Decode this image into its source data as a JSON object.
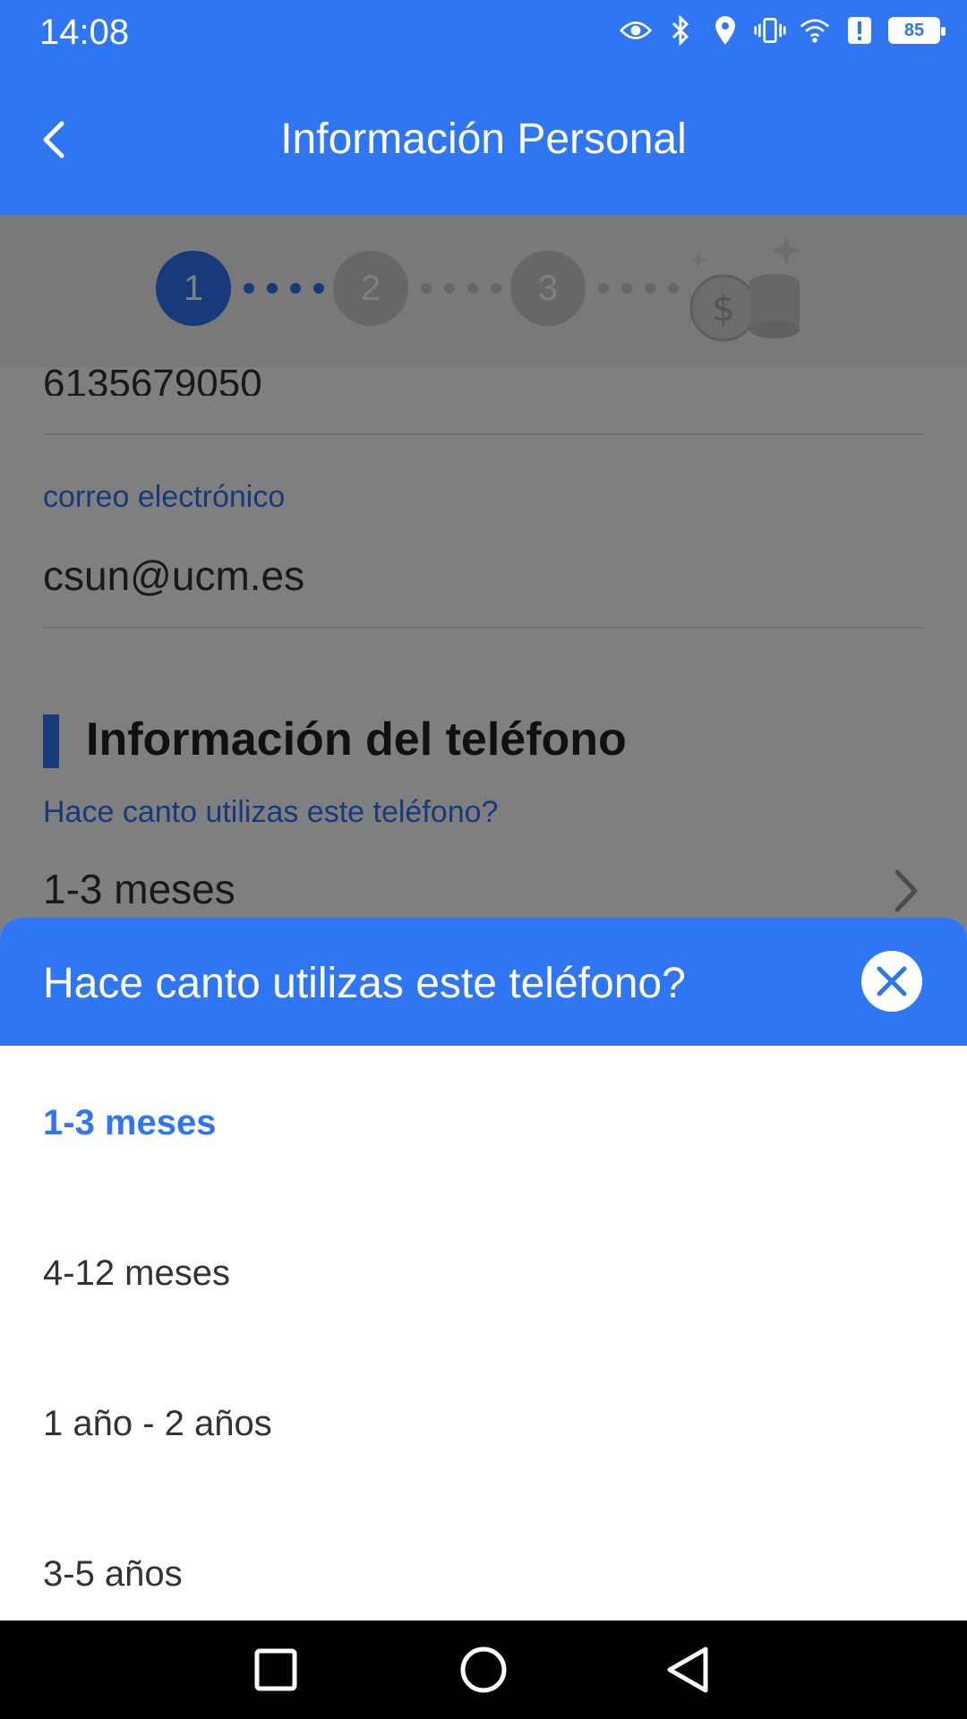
{
  "status_bar": {
    "time": "14:08",
    "battery": "85",
    "icons": [
      "eye-icon",
      "bluetooth-icon",
      "location-icon",
      "vibrate-icon",
      "wifi-icon",
      "alert-icon",
      "battery-icon"
    ]
  },
  "header": {
    "title": "Información Personal",
    "back_icon": "chevron-left-icon"
  },
  "steps": {
    "items": [
      "1",
      "2",
      "3"
    ],
    "active": "1"
  },
  "form": {
    "cut_value": "6135679050",
    "email_label": "correo electrónico",
    "email_value": "csun@ucm.es",
    "section_title": "Información del teléfono",
    "phone_usage_label": "Hace canto utilizas este teléfono?",
    "phone_usage_value": "1-3 meses"
  },
  "sheet": {
    "title": "Hace canto utilizas este teléfono?",
    "options": [
      "1-3 meses",
      "4-12 meses",
      "1 año - 2 años",
      "3-5 años"
    ],
    "selected": "1-3 meses"
  },
  "colors": {
    "primary": "#2f76f5",
    "overlay": "rgba(0,0,0,0.5)"
  }
}
